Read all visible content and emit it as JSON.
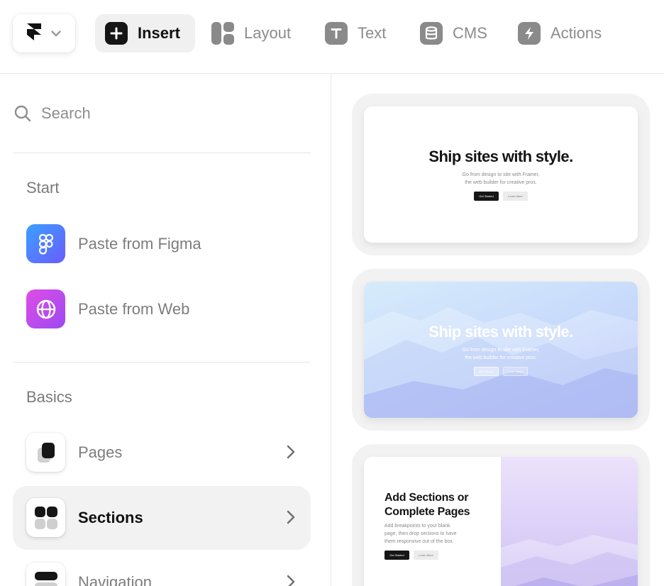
{
  "toolbar": {
    "tools": [
      {
        "label": "Insert",
        "icon": "plus-icon",
        "active": true
      },
      {
        "label": "Layout",
        "icon": "layout-icon"
      },
      {
        "label": "Text",
        "icon": "text-icon"
      },
      {
        "label": "CMS",
        "icon": "database-icon"
      },
      {
        "label": "Actions",
        "icon": "lightning-icon"
      }
    ]
  },
  "search": {
    "placeholder": "Search"
  },
  "start": {
    "title": "Start",
    "items": [
      {
        "label": "Paste from Figma",
        "icon": "figma-icon",
        "color": "#4f7dff"
      },
      {
        "label": "Paste from Web",
        "icon": "globe-icon",
        "color": "#c44bf0"
      }
    ]
  },
  "basics": {
    "title": "Basics",
    "items": [
      {
        "label": "Pages",
        "icon": "pages-icon"
      },
      {
        "label": "Sections",
        "icon": "sections-icon",
        "selected": true
      },
      {
        "label": "Navigation",
        "icon": "navigation-icon"
      }
    ]
  },
  "templates": [
    {
      "title": "Ship sites with style.",
      "sub_line1": "Go from design to site with Framer,",
      "sub_line2": "the web builder for creative pros.",
      "primary": "Get Started",
      "secondary": "Learn More"
    },
    {
      "title": "Ship sites with style.",
      "sub_line1": "Go from design to site with Framer,",
      "sub_line2": "the web builder for creative pros.",
      "primary": "Get Started",
      "secondary": "Learn More"
    },
    {
      "title_line1": "Add Sections or",
      "title_line2": "Complete Pages",
      "sub_line1": "Add breakpoints to your blank",
      "sub_line2": "page, then drop sections to have",
      "sub_line3": "them responsive out of the box.",
      "primary": "Get Started",
      "secondary": "Learn More"
    }
  ]
}
